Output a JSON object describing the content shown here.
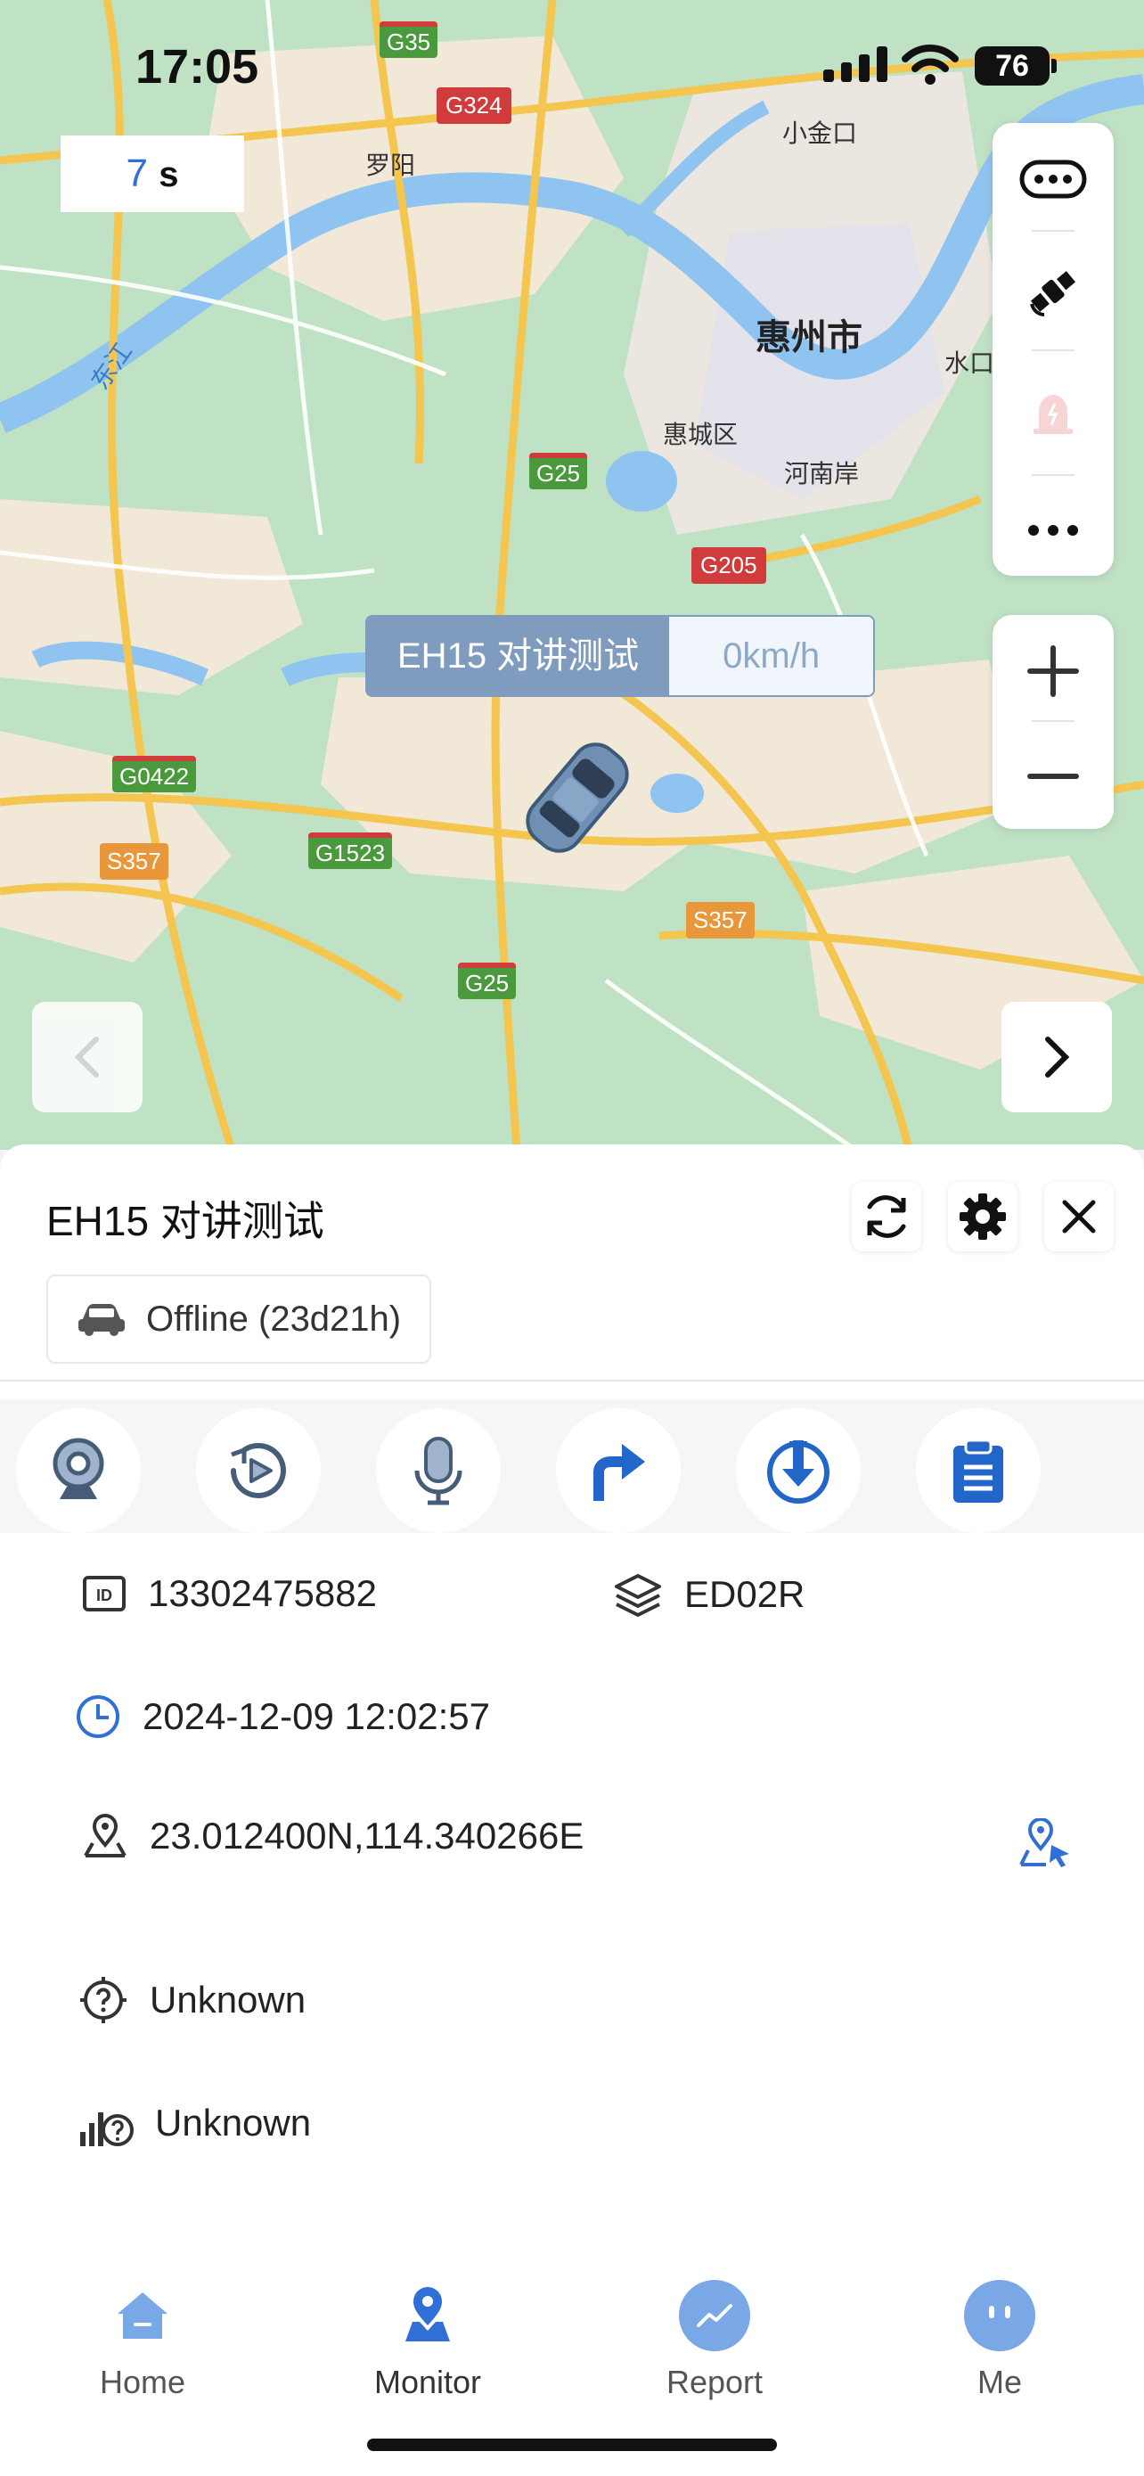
{
  "status_bar": {
    "time": "17:05",
    "battery": "76"
  },
  "timer": {
    "value": "7",
    "unit": "s"
  },
  "map": {
    "labels": [
      "小金口",
      "罗阳",
      "惠城区",
      "河南岸",
      "水口",
      "东江",
      "惠州市"
    ],
    "roads": [
      "G35",
      "G324",
      "G25",
      "G205",
      "G0422",
      "S357",
      "G1523",
      "S357",
      "G25"
    ]
  },
  "vehicle_popup": {
    "name": "EH15 对讲测试",
    "speed": "0km/h"
  },
  "sheet": {
    "title": "EH15 对讲测试",
    "status": "Offline (23d21h)",
    "info": {
      "imei": "13302475882",
      "model": "ED02R",
      "time": "2024-12-09 12:02:57",
      "coords": "23.012400N,114.340266E"
    },
    "extra": {
      "location": "Unknown",
      "signal": "Unknown"
    }
  },
  "tabs": [
    {
      "label": "Home"
    },
    {
      "label": "Monitor"
    },
    {
      "label": "Report"
    },
    {
      "label": "Me"
    }
  ],
  "colors": {
    "accent": "#2f6fd6",
    "tab_inactive": "#7aa8e6",
    "popup": "#7f9bbd"
  }
}
